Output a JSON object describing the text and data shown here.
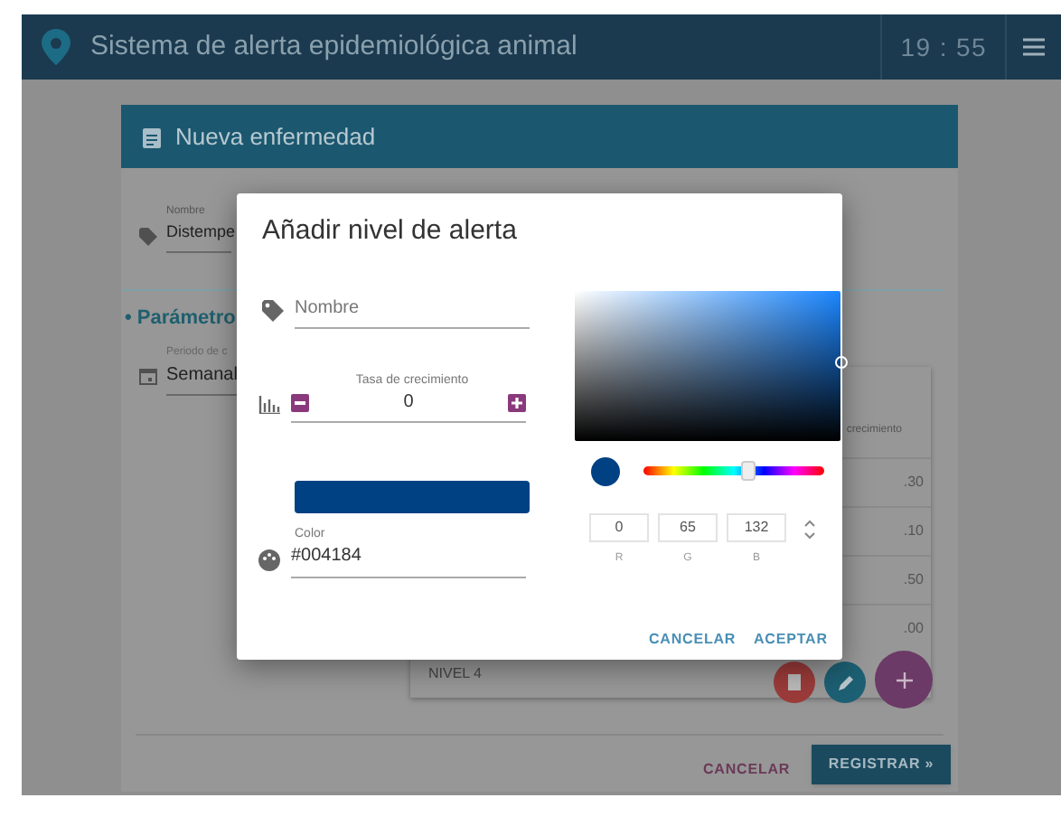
{
  "app_bar": {
    "title": "Sistema de alerta epidemiológica animal",
    "time": "19 : 55"
  },
  "card": {
    "title": "Nueva enfermedad",
    "name_field": {
      "label": "Nombre",
      "value": "Distempe"
    },
    "section": "• Parámetro",
    "period_field": {
      "label": "Periodo de c",
      "value": "Semanal"
    },
    "table": {
      "column_header": "crecimiento",
      "cells": [
        ".30",
        ".10",
        ".50",
        ".00"
      ],
      "last_row": "NIVEL 4"
    },
    "buttons": [
      "CANCELAR",
      "REGISTRAR »"
    ]
  },
  "dialog": {
    "title": "Añadir nivel de alerta",
    "name_field": {
      "placeholder": "Nombre"
    },
    "rate_field": {
      "label": "Tasa de crecimiento",
      "value": "0"
    },
    "color": "#004184",
    "color_field": {
      "label": "Color",
      "value": "#004184"
    },
    "hue_slider": {
      "level": 0.58
    },
    "rgb": [
      {
        "label": "R",
        "value": "0"
      },
      {
        "label": "G",
        "value": "65"
      },
      {
        "label": "B",
        "value": "132"
      }
    ],
    "buttons": [
      "CANCELAR",
      "ACEPTAR"
    ]
  }
}
